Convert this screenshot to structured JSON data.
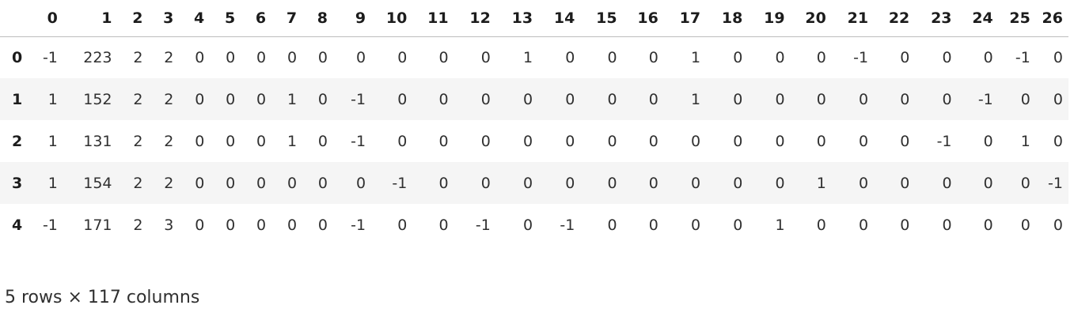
{
  "dataframe": {
    "columns": [
      "0",
      "1",
      "2",
      "3",
      "4",
      "5",
      "6",
      "7",
      "8",
      "9",
      "10",
      "11",
      "12",
      "13",
      "14",
      "15",
      "16",
      "17",
      "18",
      "19",
      "20",
      "21",
      "22",
      "23",
      "24",
      "25",
      "26"
    ],
    "index": [
      "0",
      "1",
      "2",
      "3",
      "4"
    ],
    "rows": [
      [
        "-1",
        "223",
        "2",
        "2",
        "0",
        "0",
        "0",
        "0",
        "0",
        "0",
        "0",
        "0",
        "0",
        "1",
        "0",
        "0",
        "0",
        "1",
        "0",
        "0",
        "0",
        "-1",
        "0",
        "0",
        "0",
        "-1",
        "0"
      ],
      [
        "1",
        "152",
        "2",
        "2",
        "0",
        "0",
        "0",
        "1",
        "0",
        "-1",
        "0",
        "0",
        "0",
        "0",
        "0",
        "0",
        "0",
        "1",
        "0",
        "0",
        "0",
        "0",
        "0",
        "0",
        "-1",
        "0",
        "0"
      ],
      [
        "1",
        "131",
        "2",
        "2",
        "0",
        "0",
        "0",
        "1",
        "0",
        "-1",
        "0",
        "0",
        "0",
        "0",
        "0",
        "0",
        "0",
        "0",
        "0",
        "0",
        "0",
        "0",
        "0",
        "-1",
        "0",
        "1",
        "0"
      ],
      [
        "1",
        "154",
        "2",
        "2",
        "0",
        "0",
        "0",
        "0",
        "0",
        "0",
        "-1",
        "0",
        "0",
        "0",
        "0",
        "0",
        "0",
        "0",
        "0",
        "0",
        "1",
        "0",
        "0",
        "0",
        "0",
        "0",
        "-1"
      ],
      [
        "-1",
        "171",
        "2",
        "3",
        "0",
        "0",
        "0",
        "0",
        "0",
        "-1",
        "0",
        "0",
        "-1",
        "0",
        "-1",
        "0",
        "0",
        "0",
        "0",
        "1",
        "0",
        "0",
        "0",
        "0",
        "0",
        "0",
        "0"
      ]
    ]
  },
  "footer": {
    "shape_text": "5 rows × 117 columns"
  },
  "colors": {
    "row_stripe": "#f5f5f5",
    "header_rule": "#bdbdbd",
    "text": "#303030"
  }
}
